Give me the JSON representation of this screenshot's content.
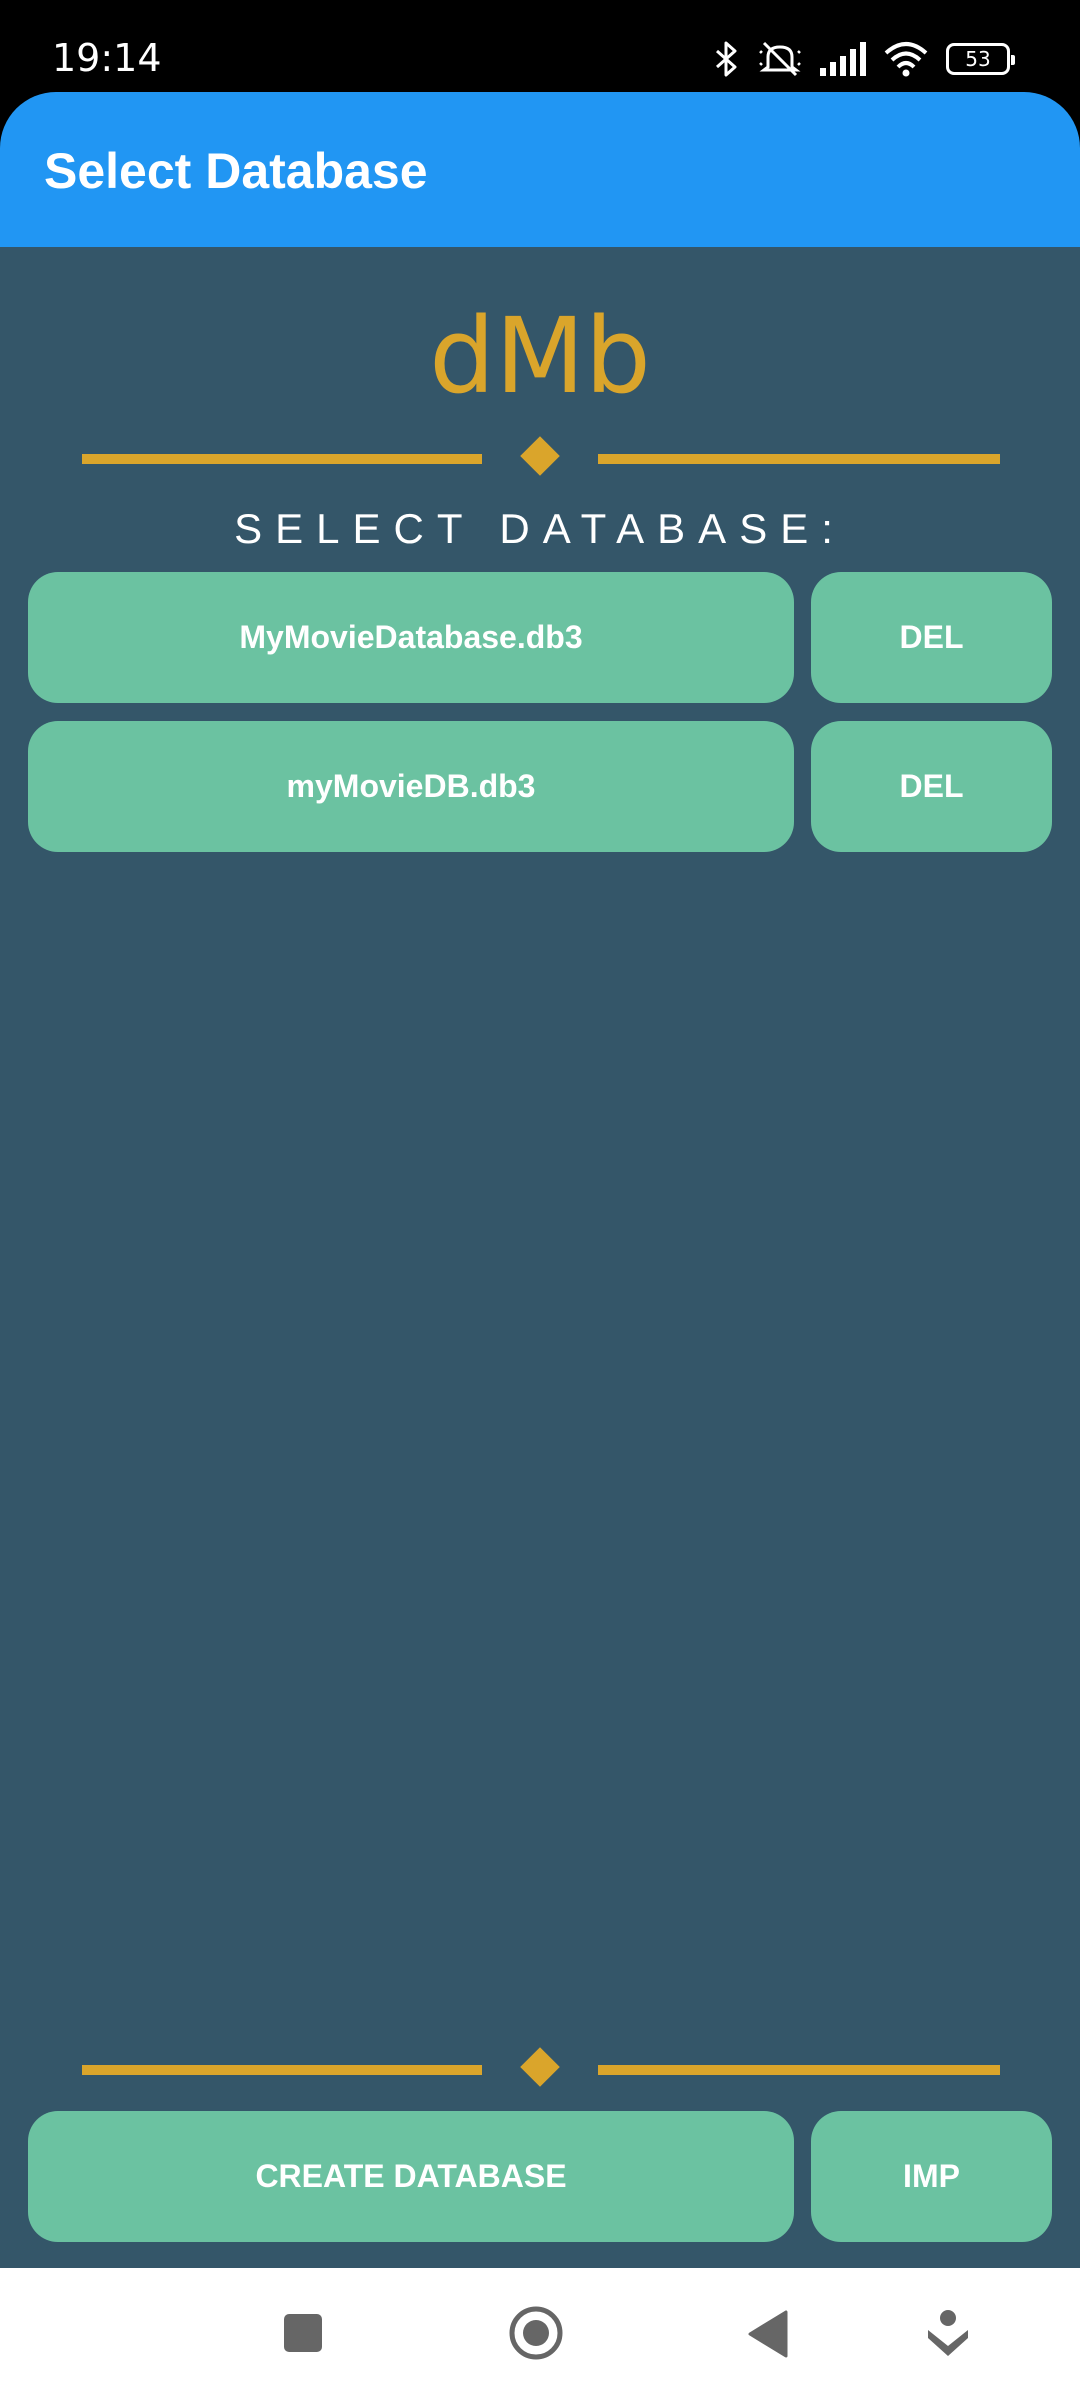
{
  "status_bar": {
    "time": "19:14",
    "icons": [
      "bluetooth-icon",
      "mute-icon",
      "signal-icon",
      "wifi-icon",
      "battery-icon"
    ],
    "battery_level": "53"
  },
  "app_bar": {
    "title": "Select Database",
    "color": "#2196F3"
  },
  "main": {
    "logo": "dMb",
    "section_label": "SELECT DATABASE:",
    "databases": [
      {
        "name": "MyMovieDatabase.db3",
        "delete_label": "DEL"
      },
      {
        "name": "myMovieDB.db3",
        "delete_label": "DEL"
      }
    ],
    "create_label": "CREATE DATABASE",
    "import_label": "IMP"
  },
  "nav_bar": {
    "icons": [
      "square-icon",
      "home-circle-icon",
      "back-triangle-icon",
      "menu-down-icon"
    ]
  },
  "colors": {
    "background": "#345669",
    "accent": "#DAA52B",
    "button": "#6BC2A1"
  }
}
